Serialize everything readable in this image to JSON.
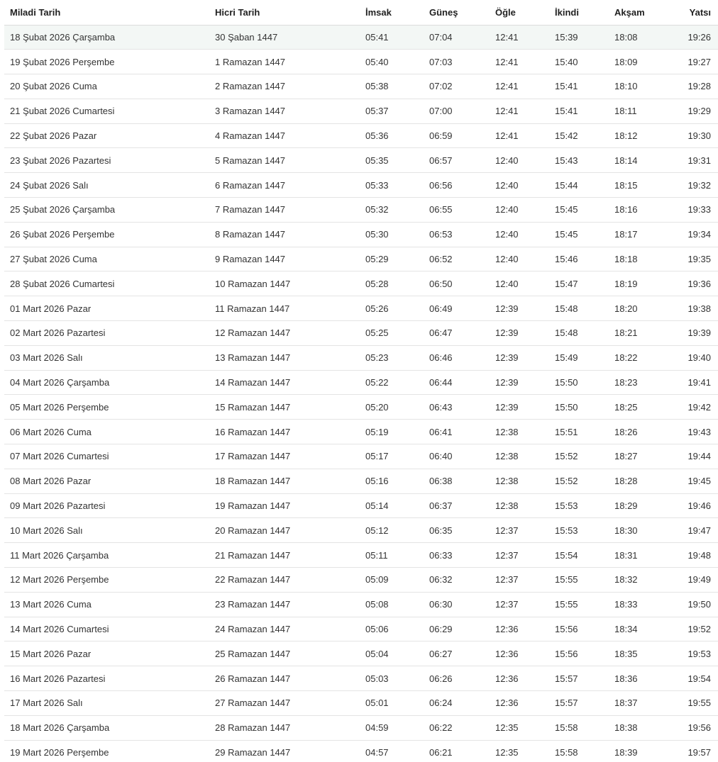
{
  "table": {
    "headers": [
      "Miladi Tarih",
      "Hicri Tarih",
      "İmsak",
      "Güneş",
      "Öğle",
      "İkindi",
      "Akşam",
      "Yatsı"
    ],
    "highlight_color": "#f3f7f5",
    "rows": [
      [
        "18 Şubat 2026 Çarşamba",
        "30 Şaban 1447",
        "05:41",
        "07:04",
        "12:41",
        "15:39",
        "18:08",
        "19:26"
      ],
      [
        "19 Şubat 2026 Perşembe",
        "1 Ramazan 1447",
        "05:40",
        "07:03",
        "12:41",
        "15:40",
        "18:09",
        "19:27"
      ],
      [
        "20 Şubat 2026 Cuma",
        "2 Ramazan 1447",
        "05:38",
        "07:02",
        "12:41",
        "15:41",
        "18:10",
        "19:28"
      ],
      [
        "21 Şubat 2026 Cumartesi",
        "3 Ramazan 1447",
        "05:37",
        "07:00",
        "12:41",
        "15:41",
        "18:11",
        "19:29"
      ],
      [
        "22 Şubat 2026 Pazar",
        "4 Ramazan 1447",
        "05:36",
        "06:59",
        "12:41",
        "15:42",
        "18:12",
        "19:30"
      ],
      [
        "23 Şubat 2026 Pazartesi",
        "5 Ramazan 1447",
        "05:35",
        "06:57",
        "12:40",
        "15:43",
        "18:14",
        "19:31"
      ],
      [
        "24 Şubat 2026 Salı",
        "6 Ramazan 1447",
        "05:33",
        "06:56",
        "12:40",
        "15:44",
        "18:15",
        "19:32"
      ],
      [
        "25 Şubat 2026 Çarşamba",
        "7 Ramazan 1447",
        "05:32",
        "06:55",
        "12:40",
        "15:45",
        "18:16",
        "19:33"
      ],
      [
        "26 Şubat 2026 Perşembe",
        "8 Ramazan 1447",
        "05:30",
        "06:53",
        "12:40",
        "15:45",
        "18:17",
        "19:34"
      ],
      [
        "27 Şubat 2026 Cuma",
        "9 Ramazan 1447",
        "05:29",
        "06:52",
        "12:40",
        "15:46",
        "18:18",
        "19:35"
      ],
      [
        "28 Şubat 2026 Cumartesi",
        "10 Ramazan 1447",
        "05:28",
        "06:50",
        "12:40",
        "15:47",
        "18:19",
        "19:36"
      ],
      [
        "01 Mart 2026 Pazar",
        "11 Ramazan 1447",
        "05:26",
        "06:49",
        "12:39",
        "15:48",
        "18:20",
        "19:38"
      ],
      [
        "02 Mart 2026 Pazartesi",
        "12 Ramazan 1447",
        "05:25",
        "06:47",
        "12:39",
        "15:48",
        "18:21",
        "19:39"
      ],
      [
        "03 Mart 2026 Salı",
        "13 Ramazan 1447",
        "05:23",
        "06:46",
        "12:39",
        "15:49",
        "18:22",
        "19:40"
      ],
      [
        "04 Mart 2026 Çarşamba",
        "14 Ramazan 1447",
        "05:22",
        "06:44",
        "12:39",
        "15:50",
        "18:23",
        "19:41"
      ],
      [
        "05 Mart 2026 Perşembe",
        "15 Ramazan 1447",
        "05:20",
        "06:43",
        "12:39",
        "15:50",
        "18:25",
        "19:42"
      ],
      [
        "06 Mart 2026 Cuma",
        "16 Ramazan 1447",
        "05:19",
        "06:41",
        "12:38",
        "15:51",
        "18:26",
        "19:43"
      ],
      [
        "07 Mart 2026 Cumartesi",
        "17 Ramazan 1447",
        "05:17",
        "06:40",
        "12:38",
        "15:52",
        "18:27",
        "19:44"
      ],
      [
        "08 Mart 2026 Pazar",
        "18 Ramazan 1447",
        "05:16",
        "06:38",
        "12:38",
        "15:52",
        "18:28",
        "19:45"
      ],
      [
        "09 Mart 2026 Pazartesi",
        "19 Ramazan 1447",
        "05:14",
        "06:37",
        "12:38",
        "15:53",
        "18:29",
        "19:46"
      ],
      [
        "10 Mart 2026 Salı",
        "20 Ramazan 1447",
        "05:12",
        "06:35",
        "12:37",
        "15:53",
        "18:30",
        "19:47"
      ],
      [
        "11 Mart 2026 Çarşamba",
        "21 Ramazan 1447",
        "05:11",
        "06:33",
        "12:37",
        "15:54",
        "18:31",
        "19:48"
      ],
      [
        "12 Mart 2026 Perşembe",
        "22 Ramazan 1447",
        "05:09",
        "06:32",
        "12:37",
        "15:55",
        "18:32",
        "19:49"
      ],
      [
        "13 Mart 2026 Cuma",
        "23 Ramazan 1447",
        "05:08",
        "06:30",
        "12:37",
        "15:55",
        "18:33",
        "19:50"
      ],
      [
        "14 Mart 2026 Cumartesi",
        "24 Ramazan 1447",
        "05:06",
        "06:29",
        "12:36",
        "15:56",
        "18:34",
        "19:52"
      ],
      [
        "15 Mart 2026 Pazar",
        "25 Ramazan 1447",
        "05:04",
        "06:27",
        "12:36",
        "15:56",
        "18:35",
        "19:53"
      ],
      [
        "16 Mart 2026 Pazartesi",
        "26 Ramazan 1447",
        "05:03",
        "06:26",
        "12:36",
        "15:57",
        "18:36",
        "19:54"
      ],
      [
        "17 Mart 2026 Salı",
        "27 Ramazan 1447",
        "05:01",
        "06:24",
        "12:36",
        "15:57",
        "18:37",
        "19:55"
      ],
      [
        "18 Mart 2026 Çarşamba",
        "28 Ramazan 1447",
        "04:59",
        "06:22",
        "12:35",
        "15:58",
        "18:38",
        "19:56"
      ],
      [
        "19 Mart 2026 Perşembe",
        "29 Ramazan 1447",
        "04:57",
        "06:21",
        "12:35",
        "15:58",
        "18:39",
        "19:57"
      ]
    ]
  }
}
